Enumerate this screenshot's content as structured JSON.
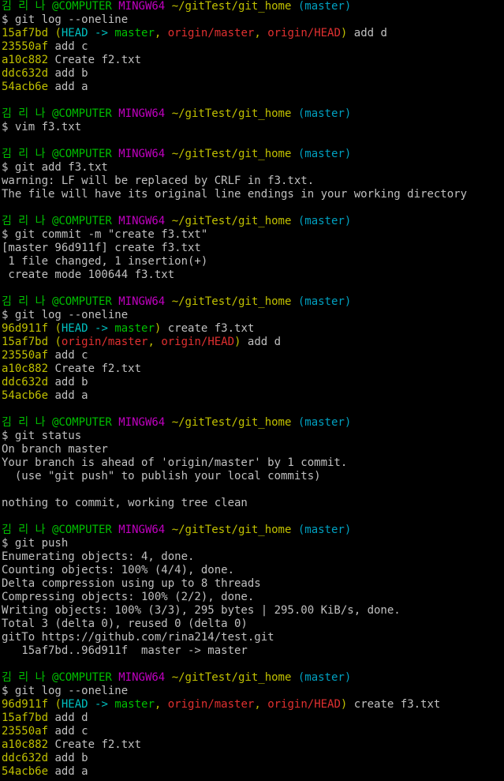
{
  "window": {
    "title": "MINGW64 ~/gitTest/git_home"
  },
  "prompt": {
    "user": "김 리 나",
    "host": "@COMPUTER",
    "env": "MINGW64",
    "path": "~/gitTest/git_home",
    "branch": "(master)"
  },
  "lines": [
    {
      "t": "prompt"
    },
    {
      "t": "text",
      "text": "$ git log --oneline"
    },
    {
      "t": "log",
      "hash": "15af7bd",
      "refs": [
        {
          "k": "paren",
          "v": " ("
        },
        {
          "k": "head",
          "v": "HEAD -> "
        },
        {
          "k": "local",
          "v": "master"
        },
        {
          "k": "paren",
          "v": ", "
        },
        {
          "k": "remote",
          "v": "origin/master"
        },
        {
          "k": "paren",
          "v": ", "
        },
        {
          "k": "remote",
          "v": "origin/HEAD"
        },
        {
          "k": "paren",
          "v": ")"
        }
      ],
      "msg": " add d"
    },
    {
      "t": "log",
      "hash": "23550af",
      "refs": [],
      "msg": " add c"
    },
    {
      "t": "log",
      "hash": "a10c882",
      "refs": [],
      "msg": " Create f2.txt"
    },
    {
      "t": "log",
      "hash": "ddc632d",
      "refs": [],
      "msg": " add b"
    },
    {
      "t": "log",
      "hash": "54acb6e",
      "refs": [],
      "msg": " add a"
    },
    {
      "t": "blank"
    },
    {
      "t": "prompt"
    },
    {
      "t": "text",
      "text": "$ vim f3.txt"
    },
    {
      "t": "blank"
    },
    {
      "t": "prompt"
    },
    {
      "t": "text",
      "text": "$ git add f3.txt"
    },
    {
      "t": "text",
      "text": "warning: LF will be replaced by CRLF in f3.txt."
    },
    {
      "t": "text",
      "text": "The file will have its original line endings in your working directory"
    },
    {
      "t": "blank"
    },
    {
      "t": "prompt"
    },
    {
      "t": "text",
      "text": "$ git commit -m \"create f3.txt\""
    },
    {
      "t": "text",
      "text": "[master 96d911f] create f3.txt"
    },
    {
      "t": "text",
      "text": " 1 file changed, 1 insertion(+)"
    },
    {
      "t": "text",
      "text": " create mode 100644 f3.txt"
    },
    {
      "t": "blank"
    },
    {
      "t": "prompt"
    },
    {
      "t": "text",
      "text": "$ git log --oneline"
    },
    {
      "t": "log",
      "hash": "96d911f",
      "refs": [
        {
          "k": "paren",
          "v": " ("
        },
        {
          "k": "head",
          "v": "HEAD -> "
        },
        {
          "k": "local",
          "v": "master"
        },
        {
          "k": "paren",
          "v": ")"
        }
      ],
      "msg": " create f3.txt"
    },
    {
      "t": "log",
      "hash": "15af7bd",
      "refs": [
        {
          "k": "paren",
          "v": " ("
        },
        {
          "k": "remote",
          "v": "origin/master"
        },
        {
          "k": "paren",
          "v": ", "
        },
        {
          "k": "remote",
          "v": "origin/HEAD"
        },
        {
          "k": "paren",
          "v": ")"
        }
      ],
      "msg": " add d"
    },
    {
      "t": "log",
      "hash": "23550af",
      "refs": [],
      "msg": " add c"
    },
    {
      "t": "log",
      "hash": "a10c882",
      "refs": [],
      "msg": " Create f2.txt"
    },
    {
      "t": "log",
      "hash": "ddc632d",
      "refs": [],
      "msg": " add b"
    },
    {
      "t": "log",
      "hash": "54acb6e",
      "refs": [],
      "msg": " add a"
    },
    {
      "t": "blank"
    },
    {
      "t": "prompt"
    },
    {
      "t": "text",
      "text": "$ git status"
    },
    {
      "t": "text",
      "text": "On branch master"
    },
    {
      "t": "text",
      "text": "Your branch is ahead of 'origin/master' by 1 commit."
    },
    {
      "t": "text",
      "text": "  (use \"git push\" to publish your local commits)"
    },
    {
      "t": "blank"
    },
    {
      "t": "text",
      "text": "nothing to commit, working tree clean"
    },
    {
      "t": "blank"
    },
    {
      "t": "prompt"
    },
    {
      "t": "text",
      "text": "$ git push"
    },
    {
      "t": "text",
      "text": "Enumerating objects: 4, done."
    },
    {
      "t": "text",
      "text": "Counting objects: 100% (4/4), done."
    },
    {
      "t": "text",
      "text": "Delta compression using up to 8 threads"
    },
    {
      "t": "text",
      "text": "Compressing objects: 100% (2/2), done."
    },
    {
      "t": "text",
      "text": "Writing objects: 100% (3/3), 295 bytes | 295.00 KiB/s, done."
    },
    {
      "t": "text",
      "text": "Total 3 (delta 0), reused 0 (delta 0)"
    },
    {
      "t": "text",
      "text": "gitTo https://github.com/rina214/test.git"
    },
    {
      "t": "text",
      "text": "   15af7bd..96d911f  master -> master"
    },
    {
      "t": "blank"
    },
    {
      "t": "prompt"
    },
    {
      "t": "text",
      "text": "$ git log --oneline"
    },
    {
      "t": "log",
      "hash": "96d911f",
      "refs": [
        {
          "k": "paren",
          "v": " ("
        },
        {
          "k": "head",
          "v": "HEAD -> "
        },
        {
          "k": "local",
          "v": "master"
        },
        {
          "k": "paren",
          "v": ", "
        },
        {
          "k": "remote",
          "v": "origin/master"
        },
        {
          "k": "paren",
          "v": ", "
        },
        {
          "k": "remote",
          "v": "origin/HEAD"
        },
        {
          "k": "paren",
          "v": ")"
        }
      ],
      "msg": " create f3.txt"
    },
    {
      "t": "log",
      "hash": "15af7bd",
      "refs": [],
      "msg": " add d"
    },
    {
      "t": "log",
      "hash": "23550af",
      "refs": [],
      "msg": " add c"
    },
    {
      "t": "log",
      "hash": "a10c882",
      "refs": [],
      "msg": " Create f2.txt"
    },
    {
      "t": "log",
      "hash": "ddc632d",
      "refs": [],
      "msg": " add b"
    },
    {
      "t": "log",
      "hash": "54acb6e",
      "refs": [],
      "msg": " add a"
    }
  ],
  "colors": {
    "background": "#000000",
    "text": "#c0c0c0",
    "user": "#00c000",
    "mingw": "#c000c0",
    "path": "#c0c000",
    "branch_prompt": "#00a0c0",
    "hash": "#c0c000",
    "head": "#00c0c0",
    "local_branch": "#00c000",
    "remote_branch": "#e03030"
  }
}
